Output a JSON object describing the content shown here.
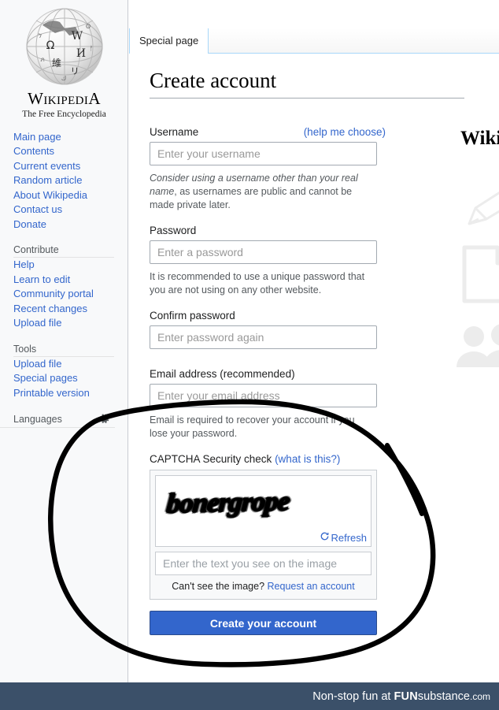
{
  "sidebar": {
    "logo": {
      "wordmark_main": "W",
      "wordmark_rest": "IKIPEDI",
      "wordmark_last": "A",
      "tagline": "The Free Encyclopedia",
      "globe_glyphs": [
        "Ω",
        "W",
        "И",
        "維",
        "リ"
      ]
    },
    "nav_groups": [
      {
        "heading": "",
        "items": [
          "Main page",
          "Contents",
          "Current events",
          "Random article",
          "About Wikipedia",
          "Contact us",
          "Donate"
        ]
      },
      {
        "heading": "Contribute",
        "items": [
          "Help",
          "Learn to edit",
          "Community portal",
          "Recent changes",
          "Upload file"
        ]
      },
      {
        "heading": "Tools",
        "items": [
          "Upload file",
          "Special pages",
          "Printable version"
        ]
      }
    ],
    "languages_heading": "Languages",
    "languages_settings_icon": "gear-icon"
  },
  "content": {
    "tab_label": "Special page",
    "page_title": "Create account",
    "fields": {
      "username": {
        "label": "Username",
        "help_link": "(help me choose)",
        "placeholder": "Enter your username",
        "value": "",
        "hint_italic": "Consider using a username other than your real name",
        "hint_rest": ", as usernames are public and cannot be made private later."
      },
      "password": {
        "label": "Password",
        "placeholder": "Enter a password",
        "value": "",
        "hint": "It is recommended to use a unique password that you are not using on any other website."
      },
      "confirm_password": {
        "label": "Confirm password",
        "placeholder": "Enter password again",
        "value": ""
      },
      "email": {
        "label": "Email address (recommended)",
        "placeholder": "Enter your email address",
        "value": "",
        "hint": "Email is required to recover your account if you lose your password."
      },
      "captcha": {
        "label": "CAPTCHA Security check",
        "what_is_this": "(what is this?)",
        "image_text": "bonergrope",
        "refresh_label": "Refresh",
        "refresh_icon": "refresh-icon",
        "placeholder": "Enter the text you see on the image",
        "value": "",
        "cant_see_text": "Can't see the image?",
        "request_account_link": "Request an account"
      }
    },
    "submit_label": "Create your account",
    "accent_color": "#3366cc",
    "link_color": "#3366cc"
  },
  "promo": {
    "title": "Wiki",
    "icons": [
      "pencil-icon",
      "document-icon",
      "people-icon"
    ]
  },
  "annotation": {
    "type": "hand-drawn-circle",
    "color": "#000000",
    "description": "black marker ellipse around CAPTCHA section"
  },
  "footer": {
    "prefix": "Non-stop fun at ",
    "brand_bold": "FUN",
    "brand_rest": "substance",
    "brand_tld": ".com",
    "background_color": "#3b5069"
  }
}
